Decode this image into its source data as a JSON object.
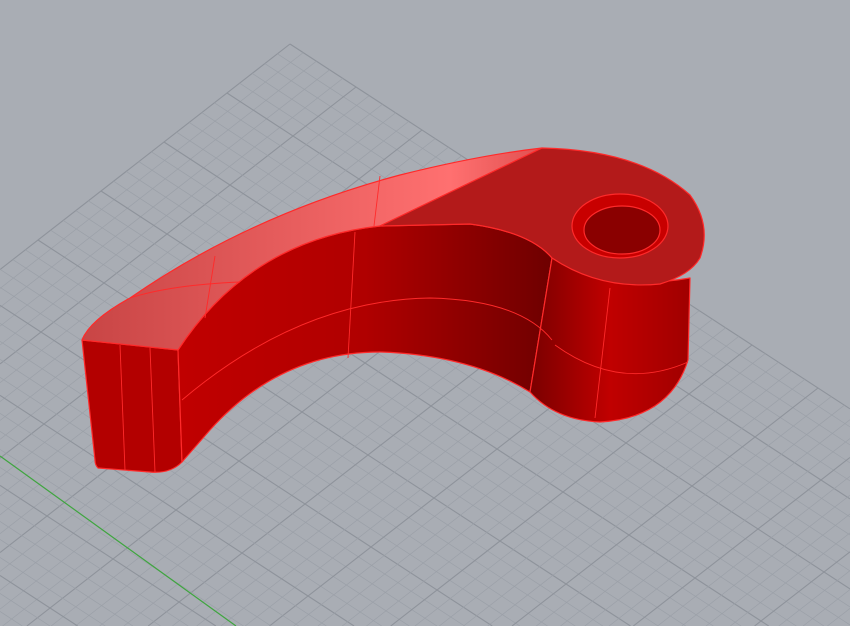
{
  "viewport": {
    "background_color": "#a9adb4",
    "grid_minor_color": "#9ba0a8",
    "grid_major_color": "#8e939b",
    "axis_color": "#3fa53f",
    "model_colors": {
      "top_face": "#f06a6a",
      "top_face_right": "#b51818",
      "front_face": "#b80000",
      "front_face_dark": "#7a0000",
      "edge": "#ff2a2a"
    }
  }
}
